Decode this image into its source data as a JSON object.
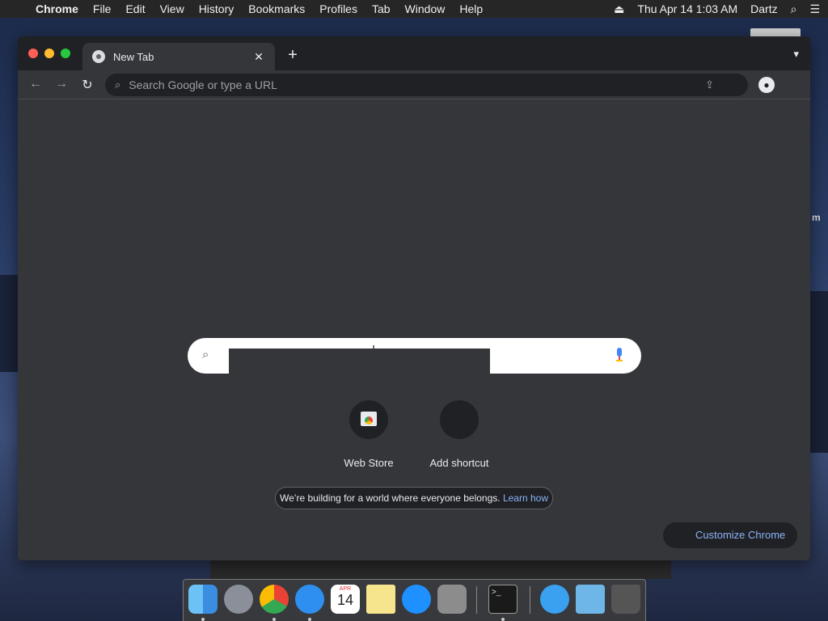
{
  "menubar": {
    "app": "Chrome",
    "items": [
      "File",
      "Edit",
      "View",
      "History",
      "Bookmarks",
      "Profiles",
      "Tab",
      "Window",
      "Help"
    ],
    "clock": "Thu Apr 14  1:03 AM",
    "user": "Dartz"
  },
  "browser": {
    "tab_title": "New Tab",
    "omnibox_placeholder": "Search Google or type a URL"
  },
  "ntp": {
    "shortcuts": [
      "Web Store",
      "Add shortcut"
    ],
    "banner_text": "We’re building for a world where everyone belongs.",
    "banner_link": "Learn how",
    "customize_label": "Customize Chrome"
  },
  "desktop": {
    "edge_text": "m"
  },
  "dock": {
    "calendar_month": "APR",
    "calendar_day": "14",
    "icons": [
      "finder",
      "launchpad",
      "chrome",
      "safari",
      "calendar",
      "notes",
      "app-store",
      "system-preferences",
      "terminal",
      "applications-folder",
      "downloads-folder",
      "trash"
    ]
  }
}
